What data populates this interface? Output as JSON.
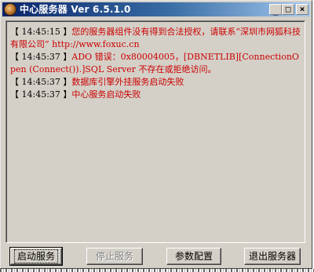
{
  "window": {
    "title": "中心服务器 Ver 6.5.1.0",
    "icon": "app-globe-icon",
    "controls": {
      "minimize": "_",
      "maximize": "□",
      "close": "×"
    }
  },
  "log": {
    "entries": [
      {
        "stamp": "【 14:45:15 】",
        "message": "您的服务器组件没有得到合法授权，请联系“深圳市网狐科技有限公司” http://www.foxuc.cn"
      },
      {
        "stamp": "【 14:45:37 】",
        "message": "ADO 错误：0x80004005，[DBNETLIB][ConnectionOpen (Connect()).]SQL Server 不存在或拒绝访问。"
      },
      {
        "stamp": "【 14:45:37 】",
        "message": "数据库引擎外挂服务启动失败"
      },
      {
        "stamp": "【 14:45:37 】",
        "message": "中心服务启动失败"
      }
    ]
  },
  "buttons": {
    "start": "启动服务",
    "stop": "停止服务",
    "config": "参数配置",
    "exit": "退出服务器"
  },
  "colors": {
    "log_message": "#cc0000",
    "titlebar_start": "#0a246a",
    "titlebar_end": "#a6caf0",
    "face": "#d4d0c8"
  }
}
